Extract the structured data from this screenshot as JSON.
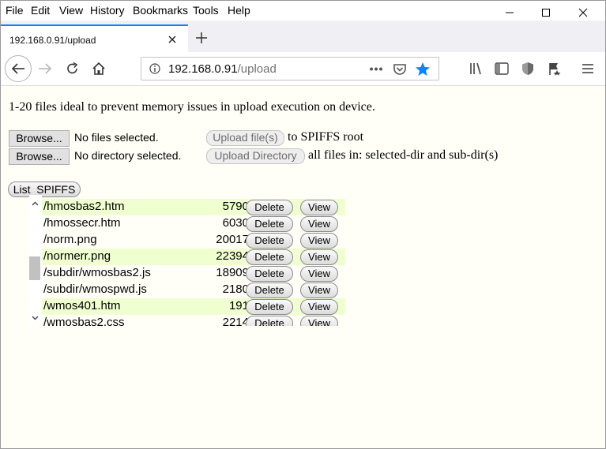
{
  "menu": [
    "File",
    "Edit",
    "View",
    "History",
    "Bookmarks",
    "Tools",
    "Help"
  ],
  "tab": {
    "title": "192.168.0.91/upload"
  },
  "url": {
    "host": "192.168.0.91",
    "path": "/upload"
  },
  "page": {
    "intro": "1-20 files ideal to prevent memory issues in upload execution on device.",
    "browse_label": "Browse...",
    "no_files": "No files selected.",
    "no_dir": "No directory selected.",
    "upload_files_label": "Upload file(s)",
    "upload_files_note": "to SPIFFS root",
    "upload_dir_label": "Upload Directory",
    "upload_dir_note": "all files in: selected-dir and sub-dir(s)",
    "list_label": "List  SPIFFS"
  },
  "files": [
    {
      "name": "/hmosbas2.htm",
      "size": "5790",
      "highlight": true
    },
    {
      "name": "/hmossecr.htm",
      "size": "6030",
      "highlight": false
    },
    {
      "name": "/norm.png",
      "size": "20017",
      "highlight": false
    },
    {
      "name": "/normerr.png",
      "size": "22394",
      "highlight": true
    },
    {
      "name": "/subdir/wmosbas2.js",
      "size": "18909",
      "highlight": false
    },
    {
      "name": "/subdir/wmospwd.js",
      "size": "2180",
      "highlight": false
    },
    {
      "name": "/wmos401.htm",
      "size": "191",
      "highlight": true
    },
    {
      "name": "/wmosbas2.css",
      "size": "2214",
      "highlight": false
    }
  ],
  "row_buttons": {
    "delete": "Delete",
    "view": "View"
  },
  "colors": {
    "accent": "#0a84ff",
    "highlight_row": "#f0ffd0"
  }
}
